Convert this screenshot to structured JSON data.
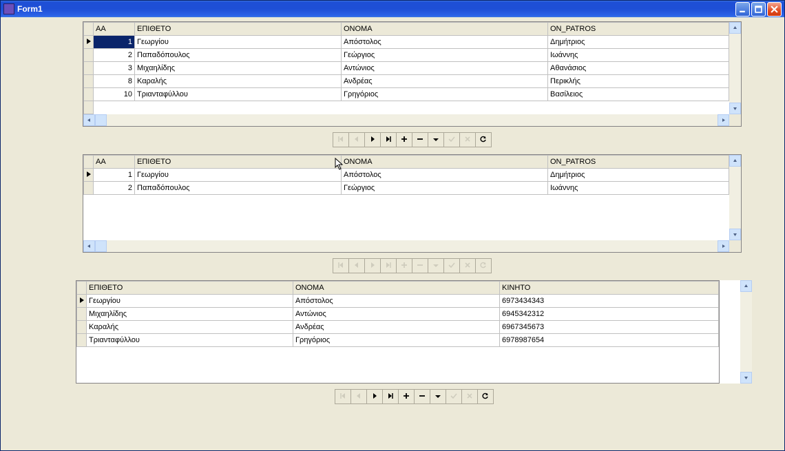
{
  "window": {
    "title": "Form1"
  },
  "grid1": {
    "columns": [
      "AA",
      "ΕΠΙΘΕΤΟ",
      "ΟΝΟΜΑ",
      "ON_PATROS"
    ],
    "rows": [
      {
        "aa": "1",
        "epitheto": "Γεωργίου",
        "onoma": "Απόστολος",
        "onpatros": "Δημήτριος"
      },
      {
        "aa": "2",
        "epitheto": "Παπαδόπουλος",
        "onoma": "Γεώργιος",
        "onpatros": "Ιωάννης"
      },
      {
        "aa": "3",
        "epitheto": "Μιχαηλίδης",
        "onoma": "Αντώνιος",
        "onpatros": "Αθανάσιος"
      },
      {
        "aa": "8",
        "epitheto": "Καραλής",
        "onoma": "Ανδρέας",
        "onpatros": "Περικλής"
      },
      {
        "aa": "10",
        "epitheto": "Τριανταφύλλου",
        "onoma": "Γρηγόριος",
        "onpatros": "Βασίλειος"
      }
    ]
  },
  "grid2": {
    "columns": [
      "AA",
      "ΕΠΙΘΕΤΟ",
      "ΟΝΟΜΑ",
      "ON_PATROS"
    ],
    "rows": [
      {
        "aa": "1",
        "epitheto": "Γεωργίου",
        "onoma": "Απόστολος",
        "onpatros": "Δημήτριος"
      },
      {
        "aa": "2",
        "epitheto": "Παπαδόπουλος",
        "onoma": "Γεώργιος",
        "onpatros": "Ιωάννης"
      }
    ]
  },
  "grid3": {
    "columns": [
      "ΕΠΙΘΕΤΟ",
      "ΟΝΟΜΑ",
      "ΚΙΝΗΤΟ"
    ],
    "rows": [
      {
        "epitheto": "Γεωργίου",
        "onoma": "Απόστολος",
        "kinito": "6973434343"
      },
      {
        "epitheto": "Μιχαηλίδης",
        "onoma": "Αντώνιος",
        "kinito": "6945342312"
      },
      {
        "epitheto": "Καραλής",
        "onoma": "Ανδρέας",
        "kinito": "6967345673"
      },
      {
        "epitheto": "Τριανταφύλλου",
        "onoma": "Γρηγόριος",
        "kinito": "6978987654"
      }
    ]
  },
  "nav_icons": [
    "first",
    "prior",
    "next",
    "last",
    "insert",
    "delete",
    "edit",
    "post",
    "cancel",
    "refresh"
  ]
}
